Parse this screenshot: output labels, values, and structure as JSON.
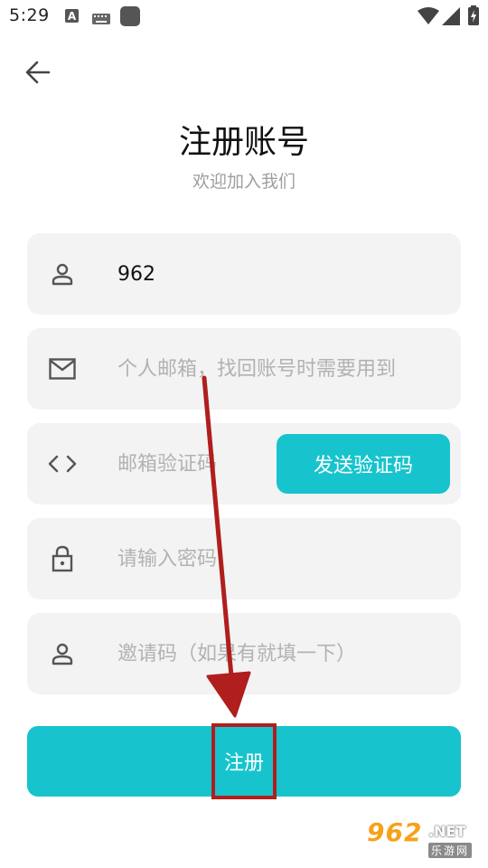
{
  "status_bar": {
    "time": "5:29"
  },
  "header": {
    "title": "注册账号",
    "subtitle": "欢迎加入我们"
  },
  "form": {
    "username": {
      "value": "962",
      "icon": "person-icon"
    },
    "email": {
      "placeholder": "个人邮箱，找回账号时需要用到",
      "icon": "mail-icon"
    },
    "verify_code": {
      "placeholder": "邮箱验证码",
      "icon": "code-icon",
      "send_button_label": "发送验证码"
    },
    "password": {
      "placeholder": "请输入密码",
      "icon": "lock-icon"
    },
    "invite_code": {
      "placeholder": "邀请码（如果有就填一下）",
      "icon": "person-icon"
    }
  },
  "register_button": {
    "label": "注册"
  },
  "colors": {
    "accent": "#17c4cd",
    "field_bg": "#f3f3f3",
    "annotation": "#b01e1e"
  },
  "watermark": {
    "number": "962",
    "domain": ".NET",
    "chinese": "乐游网"
  }
}
